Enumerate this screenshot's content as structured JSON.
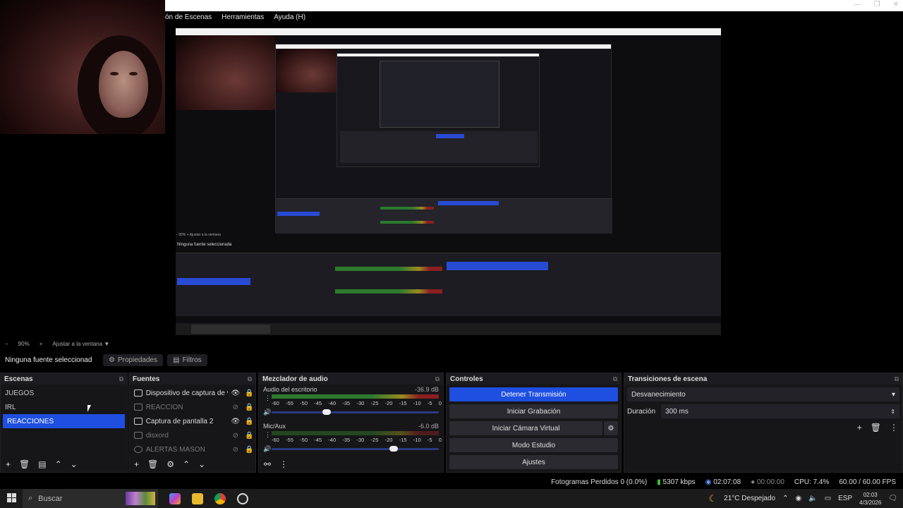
{
  "menu": {
    "items": [
      "ón de Escenas",
      "Herramientas",
      "Ayuda (H)"
    ]
  },
  "zoom": {
    "minus": "−",
    "level": "90%",
    "plus": "+",
    "fit_label": "Ajustar a la ventana"
  },
  "properties_bar": {
    "no_source": "Ninguna fuente seleccionad",
    "properties": "Propiedades",
    "filters": "Filtros"
  },
  "scenes": {
    "title": "Escenas",
    "items": [
      "JUEGOS",
      "IRL",
      "REACCIONES"
    ],
    "selected": "REACCIONES"
  },
  "sources": {
    "title": "Fuentes",
    "items": [
      {
        "label": "Dispositivo de captura de vide",
        "visible": true,
        "icon": "camera-icon"
      },
      {
        "label": "REACCION",
        "visible": false,
        "icon": "window-icon"
      },
      {
        "label": "Captura de pantalla 2",
        "visible": true,
        "icon": "monitor-icon"
      },
      {
        "label": "disxord",
        "visible": false,
        "icon": "window-icon"
      },
      {
        "label": "ALERTAS MASON",
        "visible": false,
        "icon": "globe-icon"
      }
    ]
  },
  "mixer": {
    "title": "Mezclador de audio",
    "channels": [
      {
        "name": "Audio del escritorio",
        "db": "-36.9 dB",
        "level": 0.42,
        "volume": 0.33
      },
      {
        "name": "Mic/Aux",
        "db": "-6.0 dB",
        "level": 0.0,
        "volume": 0.73
      }
    ],
    "ticks": [
      "-60",
      "-55",
      "-50",
      "-45",
      "-40",
      "-35",
      "-30",
      "-25",
      "-20",
      "-15",
      "-10",
      "-5",
      "0"
    ]
  },
  "controls": {
    "title": "Controles",
    "stop_stream": "Detener Transmisión",
    "start_record": "Iniciar Grabación",
    "virtual_cam": "Iniciar Cámara Virtual",
    "studio": "Modo Estudio",
    "settings": "Ajustes"
  },
  "transitions": {
    "title": "Transiciones de escena",
    "selected": "Desvanecimiento",
    "duration_label": "Duración",
    "duration": "300 ms"
  },
  "status": {
    "dropped": "Fotogramas Perdidos 0 (0.0%)",
    "bitrate": "5307 kbps",
    "stream_time": "02:07:08",
    "record_time": "00:00:00",
    "cpu": "CPU: 7.4%",
    "fps": "60.00 / 60.00 FPS"
  },
  "taskbar": {
    "search_placeholder": "Buscar",
    "weather": "21°C  Despejado",
    "lang": "ESP",
    "time": "02:03",
    "date": "4/3/2026"
  },
  "colors": {
    "accent": "#1e4fe0",
    "panel": "#161619",
    "bg": "#000000"
  }
}
